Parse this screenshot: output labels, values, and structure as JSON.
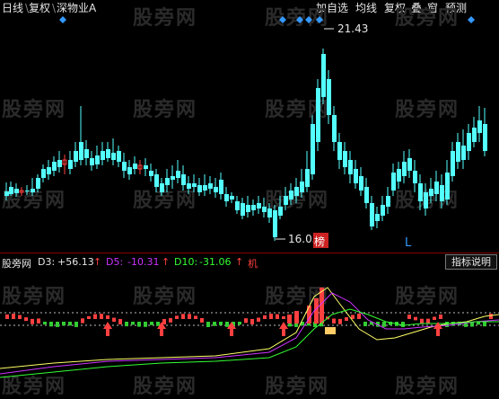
{
  "top_left": {
    "period": "日线",
    "adjust": "复权",
    "stock_name": "深物业A"
  },
  "top_right": {
    "items": [
      "加自选",
      "均线",
      "复权",
      "叠",
      "窗",
      "预测"
    ]
  },
  "price_labels": {
    "high": "21.43",
    "low": "16.05"
  },
  "markers": {
    "bang": "榜",
    "l": "L"
  },
  "indicator": {
    "name": "股旁网",
    "d3_label": "D3:",
    "d3_value": "+56.13",
    "d5_label": "D5:",
    "d5_value": "-10.31",
    "d10_label": "D10:",
    "d10_value": "-31.06",
    "ji": "机",
    "button": "指标说明",
    "colors": {
      "d3": "#e6e6e6",
      "d5": "#cc33ff",
      "d10": "#33ff33",
      "ji": "#ff4040"
    }
  },
  "watermark": "股旁网",
  "colors": {
    "up": "#ff4040",
    "down": "#54ffff",
    "diamond": "#3399ff",
    "grid": "#8b0000"
  }
}
